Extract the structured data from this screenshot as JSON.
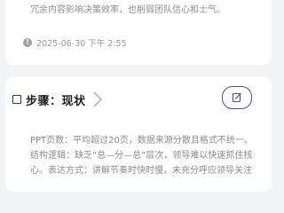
{
  "card1": {
    "body_text": "冗余内容影响决策效率，也削弱团队信心和士气。",
    "timestamp": "2025-06-30 下午 2:55",
    "timestamp_icon": "info-icon"
  },
  "card2": {
    "title": "步骤：现状",
    "edit_icon": "edit-icon",
    "chevron_icon": "chevron-right-icon",
    "lines": [
      "PPT页数：平均超过20页，数据来源分散且格式不统一。",
      "结构逻辑：缺乏“总—分—总”层次，领导难以快速抓住核",
      "心。表达方式：讲解节奏时快时慢，未充分呼应领导关注"
    ]
  },
  "colors": {
    "accent": "#4a46c8",
    "page_bg": "#f2f3f5",
    "card_bg": "#ffffff",
    "muted_text": "#8c8c8c"
  }
}
